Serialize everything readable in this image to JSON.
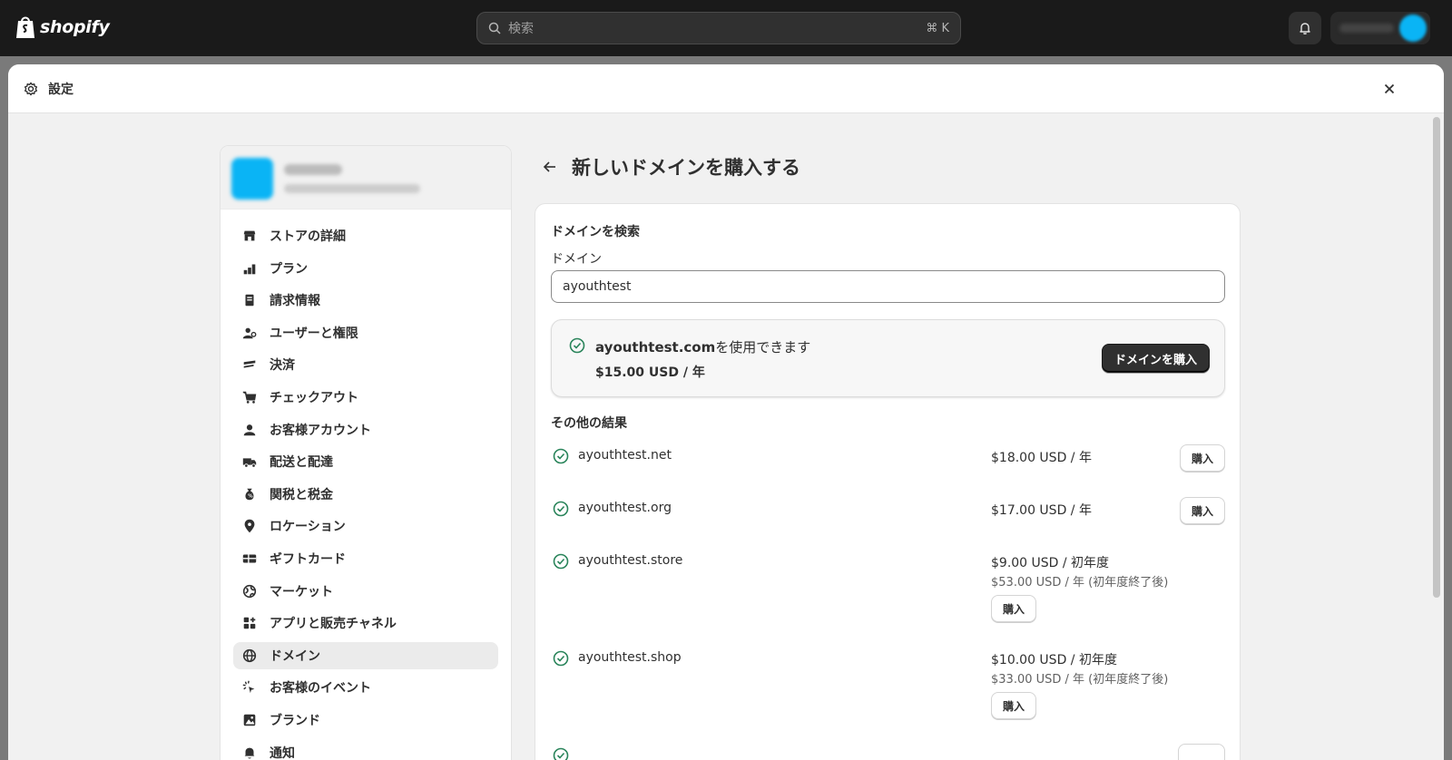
{
  "topbar": {
    "brand": "shopify",
    "search_placeholder": "検索",
    "search_shortcut": "⌘ K"
  },
  "modal": {
    "title": "設定"
  },
  "sidebar": {
    "items": [
      {
        "label": "ストアの詳細",
        "icon": "store-icon"
      },
      {
        "label": "プラン",
        "icon": "plan-icon"
      },
      {
        "label": "請求情報",
        "icon": "billing-icon"
      },
      {
        "label": "ユーザーと権限",
        "icon": "users-icon"
      },
      {
        "label": "決済",
        "icon": "payments-icon"
      },
      {
        "label": "チェックアウト",
        "icon": "cart-icon"
      },
      {
        "label": "お客様アカウント",
        "icon": "person-icon"
      },
      {
        "label": "配送と配達",
        "icon": "truck-icon"
      },
      {
        "label": "関税と税金",
        "icon": "tax-icon"
      },
      {
        "label": "ロケーション",
        "icon": "location-icon"
      },
      {
        "label": "ギフトカード",
        "icon": "gift-card-icon"
      },
      {
        "label": "マーケット",
        "icon": "globe-icon"
      },
      {
        "label": "アプリと販売チャネル",
        "icon": "apps-icon"
      },
      {
        "label": "ドメイン",
        "icon": "domain-globe-icon",
        "active": true
      },
      {
        "label": "お客様のイベント",
        "icon": "events-icon"
      },
      {
        "label": "ブランド",
        "icon": "brand-icon"
      },
      {
        "label": "通知",
        "icon": "bell-icon"
      }
    ]
  },
  "main": {
    "title": "新しいドメインを購入する",
    "search_section_title": "ドメインを検索",
    "domain_label": "ドメイン",
    "domain_value": "ayouthtest",
    "available": {
      "domain": "ayouthtest.com",
      "suffix": "を使用できます",
      "price": "$15.00 USD / 年",
      "buy_label": "ドメインを購入"
    },
    "other_results_title": "その他の結果",
    "results": [
      {
        "domain": "ayouthtest.net",
        "price": "$18.00 USD / 年",
        "sub": "",
        "buy": "購入"
      },
      {
        "domain": "ayouthtest.org",
        "price": "$17.00 USD / 年",
        "sub": "",
        "buy": "購入"
      },
      {
        "domain": "ayouthtest.store",
        "price": "$9.00 USD / 初年度",
        "sub": "$53.00 USD / 年 (初年度終了後)",
        "buy": "購入"
      },
      {
        "domain": "ayouthtest.shop",
        "price": "$10.00 USD / 初年度",
        "sub": "$33.00 USD / 年 (初年度終了後)",
        "buy": "購入"
      }
    ]
  },
  "colors": {
    "topbar": "#1a1a1a",
    "check_green": "#29845a",
    "primary_button": "#303030"
  }
}
